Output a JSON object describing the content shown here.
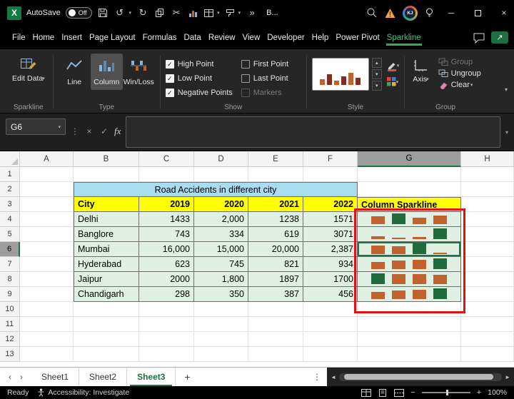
{
  "titlebar": {
    "autosave_label": "AutoSave",
    "autosave_state": "Off",
    "doc_title": "B...",
    "avatar_initials": "KJ"
  },
  "menubar": {
    "tabs": [
      "File",
      "Home",
      "Insert",
      "Page Layout",
      "Formulas",
      "Data",
      "Review",
      "View",
      "Developer",
      "Help",
      "Power Pivot",
      "Sparkline"
    ],
    "active_tab": "Sparkline"
  },
  "ribbon": {
    "edit_data_label": "Edit Data",
    "group_labels": [
      "Sparkline",
      "Type",
      "Show",
      "Style",
      "Group"
    ],
    "type_buttons": [
      {
        "label": "Line",
        "selected": false
      },
      {
        "label": "Column",
        "selected": true
      },
      {
        "label": "Win/Loss",
        "selected": false
      }
    ],
    "show_checkboxes": [
      {
        "label": "High Point",
        "checked": true,
        "disabled": false
      },
      {
        "label": "First Point",
        "checked": false,
        "disabled": false
      },
      {
        "label": "Low Point",
        "checked": true,
        "disabled": false
      },
      {
        "label": "Last Point",
        "checked": false,
        "disabled": false
      },
      {
        "label": "Negative Points",
        "checked": true,
        "disabled": false
      },
      {
        "label": "Markers",
        "checked": false,
        "disabled": true
      }
    ],
    "axis_label": "Axis",
    "group_label": "Group",
    "ungroup_label": "Ungroup",
    "clear_label": "Clear"
  },
  "formula_bar": {
    "name_box": "G6",
    "fx_label": "fx",
    "formula_value": ""
  },
  "grid": {
    "col_headers": [
      "A",
      "B",
      "C",
      "D",
      "E",
      "F",
      "G",
      "H"
    ],
    "row_count": 13,
    "selected_col": "G",
    "selected_row": 6,
    "active_cell": "G6"
  },
  "sheet_table": {
    "title": "Road Accidents in different city",
    "columns": [
      "City",
      "2019",
      "2020",
      "2021",
      "2022",
      "Column Sparkline"
    ],
    "rows": [
      {
        "city": "Delhi",
        "display": [
          "1433",
          "2,000",
          "1238",
          "1571"
        ],
        "values": [
          1433,
          2000,
          1238,
          1571
        ]
      },
      {
        "city": "Banglore",
        "display": [
          "743",
          "334",
          "619",
          "3071"
        ],
        "values": [
          743,
          334,
          619,
          3071
        ]
      },
      {
        "city": "Mumbai",
        "display": [
          "16,000",
          "15,000",
          "20,000",
          "2,387"
        ],
        "values": [
          16000,
          15000,
          20000,
          2387
        ]
      },
      {
        "city": "Hyderabad",
        "display": [
          "623",
          "745",
          "821",
          "934"
        ],
        "values": [
          623,
          745,
          821,
          934
        ]
      },
      {
        "city": "Jaipur",
        "display": [
          "2000",
          "1,800",
          "1897",
          "1700"
        ],
        "values": [
          2000,
          1800,
          1897,
          1700
        ]
      },
      {
        "city": "Chandigarh",
        "display": [
          "298",
          "350",
          "387",
          "456"
        ],
        "values": [
          298,
          350,
          387,
          456
        ]
      }
    ]
  },
  "chart_data": {
    "type": "bar",
    "subtype": "column-sparklines-in-cells-G4-G9",
    "categories": [
      "2019",
      "2020",
      "2021",
      "2022"
    ],
    "series": [
      {
        "name": "Delhi",
        "values": [
          1433,
          2000,
          1238,
          1571
        ]
      },
      {
        "name": "Banglore",
        "values": [
          743,
          334,
          619,
          3071
        ]
      },
      {
        "name": "Mumbai",
        "values": [
          16000,
          15000,
          20000,
          2387
        ]
      },
      {
        "name": "Hyderabad",
        "values": [
          623,
          745,
          821,
          934
        ]
      },
      {
        "name": "Jaipur",
        "values": [
          2000,
          1800,
          1897,
          1700
        ]
      },
      {
        "name": "Chandigarh",
        "values": [
          298,
          350,
          387,
          456
        ]
      }
    ],
    "bar_color": "#c0622d",
    "high_point_color": "#1f6b3b"
  },
  "sheet_tabs": {
    "sheets": [
      "Sheet1",
      "Sheet2",
      "Sheet3"
    ],
    "active": "Sheet3"
  },
  "status_bar": {
    "ready_label": "Ready",
    "accessibility_label": "Accessibility: Investigate",
    "zoom_level": "100%"
  },
  "colors": {
    "excel_green": "#217346",
    "title_fill": "#aadcf0",
    "header_fill": "#ffff00",
    "data_fill": "#dff0e3",
    "annotation_red": "#e01212"
  }
}
